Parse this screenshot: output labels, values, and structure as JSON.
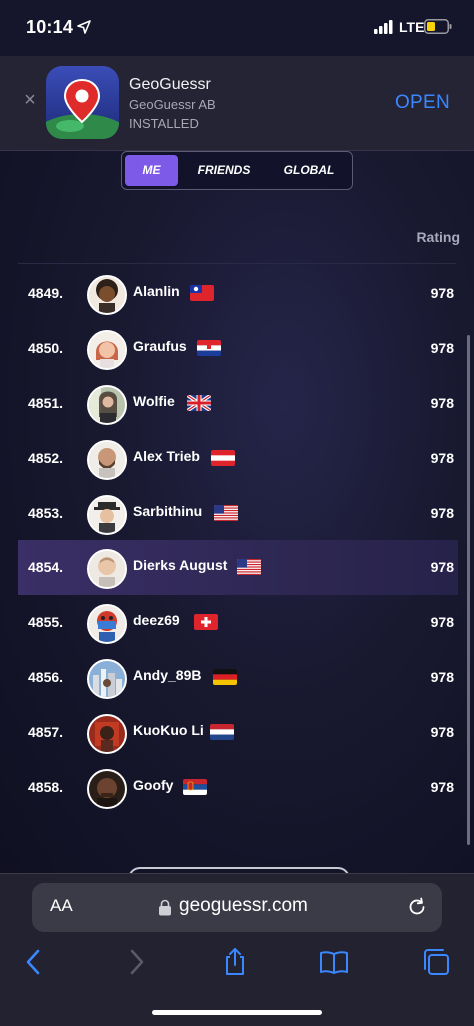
{
  "status_bar": {
    "time": "10:14",
    "network": "LTE"
  },
  "banner": {
    "close_symbol": "×",
    "app_name": "GeoGuessr",
    "developer": "GeoGuessr AB",
    "install_state": "INSTALLED",
    "open_label": "OPEN"
  },
  "tabs": [
    {
      "label": "ME",
      "active": true
    },
    {
      "label": "FRIENDS",
      "active": false
    },
    {
      "label": "GLOBAL",
      "active": false
    }
  ],
  "leaderboard": {
    "rating_header": "Rating",
    "highlight_color": "#3a2f66",
    "rows": [
      {
        "rank": "4849.",
        "name": "Alanlin",
        "flag": "taiwan",
        "rating": "978",
        "avatar": "dark-skin-curly-hair"
      },
      {
        "rank": "4850.",
        "name": "Graufus",
        "flag": "croatia",
        "rating": "978",
        "avatar": "light-skin-red-hair"
      },
      {
        "rank": "4851.",
        "name": "Wolfie",
        "flag": "uk",
        "rating": "978",
        "avatar": "photo-person"
      },
      {
        "rank": "4852.",
        "name": "Alex Trieb",
        "flag": "austria",
        "rating": "978",
        "avatar": "bald-beard"
      },
      {
        "rank": "4853.",
        "name": "Sarbithinu",
        "flag": "usa",
        "rating": "978",
        "avatar": "hat-person"
      },
      {
        "rank": "4854.",
        "name": "Dierks August",
        "flag": "usa",
        "rating": "978",
        "avatar": "light-bald",
        "highlighted": true
      },
      {
        "rank": "4855.",
        "name": "deez69",
        "flag": "switzerland",
        "rating": "978",
        "avatar": "masked-red"
      },
      {
        "rank": "4856.",
        "name": "Andy_89B",
        "flag": "germany",
        "rating": "978",
        "avatar": "photo-city"
      },
      {
        "rank": "4857.",
        "name": "KuoKuo Li",
        "flag": "netherlands",
        "rating": "978",
        "avatar": "photo-red"
      },
      {
        "rank": "4858.",
        "name": "Goofy",
        "flag": "serbia",
        "rating": "978",
        "avatar": "photo-face"
      }
    ]
  },
  "safari": {
    "text_size_label": "AA",
    "url": "geoguessr.com",
    "toolbar": [
      "back-icon",
      "forward-icon",
      "share-icon",
      "bookmarks-icon",
      "tabs-icon"
    ]
  },
  "colors": {
    "accent": "#7d5ae8",
    "open_blue": "#3b87ff",
    "background": "#15152b"
  }
}
